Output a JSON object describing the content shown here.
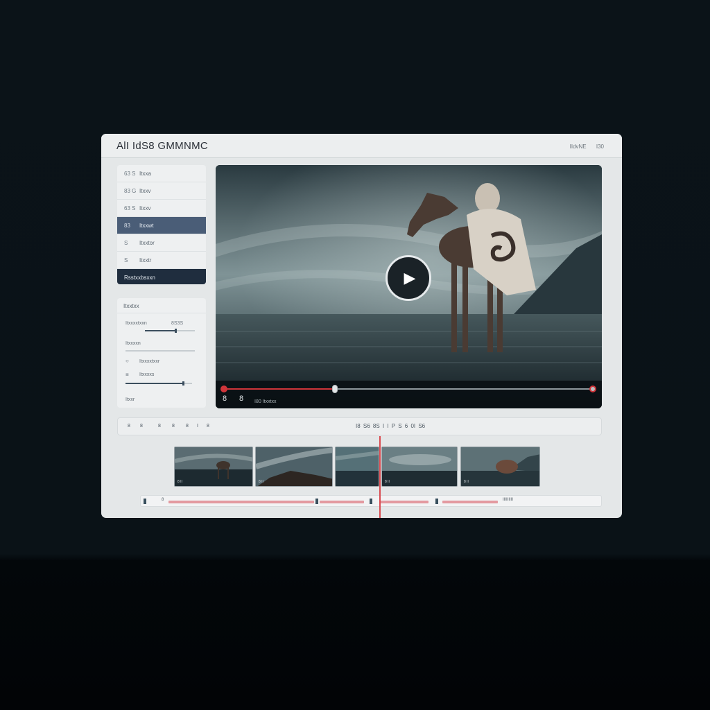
{
  "window": {
    "title": "AlI IdS8 GMMNMC",
    "right_info": [
      "IIdvNE",
      "I30"
    ]
  },
  "nav": {
    "items": [
      {
        "icon": "63 S",
        "label": "Itxxa"
      },
      {
        "icon": "83 G",
        "label": "Itxxv"
      },
      {
        "icon": "63 S",
        "label": "Itxxv"
      },
      {
        "icon": "83",
        "label": "Itxxwt"
      },
      {
        "icon": "S",
        "label": "Itxxtor"
      },
      {
        "icon": "S",
        "label": "Itxxtr"
      },
      {
        "icon": "",
        "label": "Rsstxxbsxxn"
      }
    ]
  },
  "settings": {
    "header": "Itxxtxx",
    "row1_label": "Itxxxxtxxn",
    "row1_value": "8S3S",
    "slider1_value": 0.6,
    "row2_label": "Itxxxxn",
    "row3_label": "Itxxxxtxxr",
    "row4_label": "Itxxxxs",
    "slider2_value": 0.85,
    "footer_label": "Itxxr"
  },
  "player": {
    "play_icon": "play-icon",
    "progress": 0.3,
    "time_label": "I80 Itxxtxx",
    "ctrl_icon_1": "8",
    "ctrl_icon_2": "8"
  },
  "toolbar": {
    "tools": [
      "8",
      "8",
      "8",
      "8",
      "8",
      "I",
      "8"
    ],
    "timecode": "I8 S6 8S I I  P S 6 0I S6"
  },
  "timeline": {
    "clips": [
      {
        "caption": "8 II"
      },
      {
        "caption": "8 II"
      },
      {
        "caption": ""
      },
      {
        "caption": "8 II"
      },
      {
        "caption": "8 II"
      }
    ],
    "track_left": "8",
    "track_right": "IIIIIIIII"
  },
  "colors": {
    "accent_red": "#d0353a",
    "nav_active": "#4a5d77",
    "nav_active_dark": "#1f2d3e",
    "page_bg": "#0b1318"
  }
}
